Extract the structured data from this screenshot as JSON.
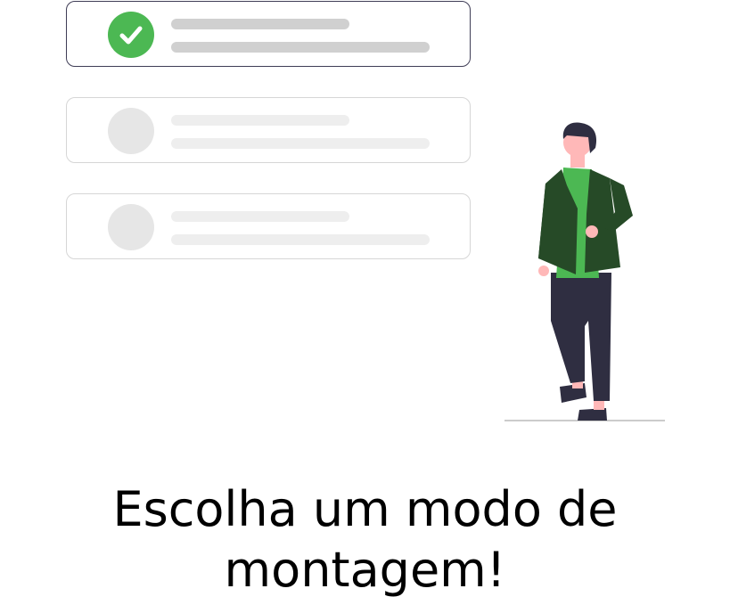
{
  "options": [
    {
      "selected": true,
      "status_icon": "checkmark-icon"
    },
    {
      "selected": false,
      "status_icon": "empty-circle-icon"
    },
    {
      "selected": false,
      "status_icon": "empty-circle-icon"
    }
  ],
  "colors": {
    "selected_border": "#3f3d56",
    "unselected_border": "#d6d6d6",
    "check_green": "#4cb853",
    "placeholder_light": "#eeeeee",
    "placeholder_dark": "#d0d0d0",
    "jacket": "#264a27",
    "shirt": "#4cb853",
    "pants": "#2f2e41",
    "skin": "#ffb8b8"
  },
  "heading": {
    "line1": "Escolha um modo de",
    "line2": "montagem!"
  },
  "illustration": {
    "subject": "person-standing-illustration"
  }
}
